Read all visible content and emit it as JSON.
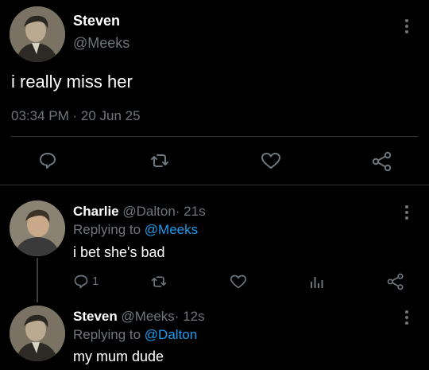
{
  "main_tweet": {
    "display_name": "Steven",
    "handle": "@Meeks",
    "text": "i really miss her",
    "time": "03:34 PM",
    "separator": "·",
    "date": "20 Jun 25"
  },
  "replies": [
    {
      "display_name": "Charlie",
      "handle": "@Dalton",
      "age": "· 21s",
      "replying_prefix": "Replying to",
      "replying_to": "@Meeks",
      "text": "i bet she's bad",
      "reply_count": "1"
    },
    {
      "display_name": "Steven",
      "handle": "@Meeks",
      "age": "· 12s",
      "replying_prefix": "Replying to",
      "replying_to": "@Dalton",
      "text": "my mum dude"
    }
  ],
  "icons": {
    "reply": "reply-icon",
    "retweet": "retweet-icon",
    "like": "heart-icon",
    "analytics": "analytics-icon",
    "share": "share-icon",
    "more": "more-options-icon"
  },
  "colors": {
    "background": "#000000",
    "text": "#e7e9ea",
    "muted": "#6e767d",
    "link": "#1d9bf0",
    "divider": "#2f3336"
  }
}
